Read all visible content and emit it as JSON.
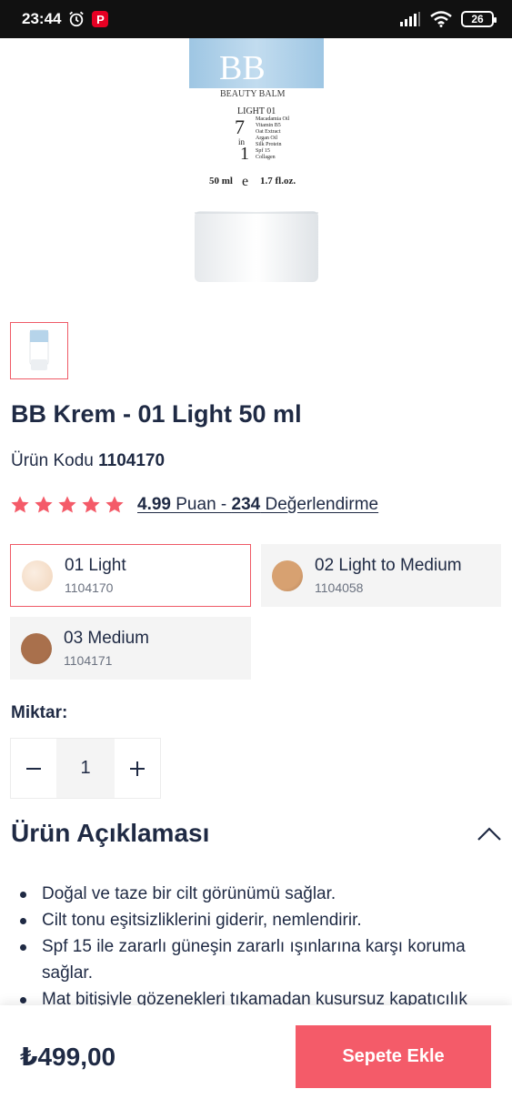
{
  "status_bar": {
    "time": "23:44",
    "battery": "26",
    "pin_badge": "P"
  },
  "product_image": {
    "tube_text": [
      "BB",
      "BEAUTY BALM",
      "LIGHT 01",
      "7",
      "in",
      "1",
      "Macadamia Oil",
      "Vitamin B5",
      "Oat Extract",
      "Argan Oil",
      "Silk Protein",
      "Spf 15",
      "Collagen",
      "50 ml",
      "e",
      "1.7 fl.oz."
    ]
  },
  "product": {
    "title": "BB Krem - 01 Light 50 ml",
    "code_label": "Ürün Kodu",
    "code_value": "1104170"
  },
  "rating": {
    "stars": 5,
    "score": "4.99",
    "score_suffix": " Puan - ",
    "count": "234",
    "count_suffix": " Değerlendirme",
    "star_color": "#f45b69"
  },
  "variants": [
    {
      "name": "01 Light",
      "code": "1104170",
      "color": "#f4dcc6",
      "selected": true
    },
    {
      "name": "02 Light to Medium",
      "code": "1104058",
      "color": "#d7a171",
      "selected": false
    },
    {
      "name": "03 Medium",
      "code": "1104171",
      "color": "#a9704c",
      "selected": false
    }
  ],
  "quantity": {
    "label": "Miktar:",
    "value": "1",
    "minus_icon": "minus-icon",
    "plus_icon": "plus-icon"
  },
  "description": {
    "title": "Ürün Açıklaması",
    "toggle_icon": "chevron-up-icon",
    "items": [
      "Doğal ve taze bir cilt görünümü sağlar.",
      "Cilt tonu eşitsizliklerini giderir, nemlendirir.",
      "Spf 15 ile zararlı güneşin zararlı ışınlarına karşı koruma sağlar.",
      "Mat bitişiyle gözenekleri tıkamadan kusursuz kapatıcılık"
    ]
  },
  "bottom_bar": {
    "price": "₺499,00",
    "cart_label": "Sepete Ekle",
    "accent": "#f45b69"
  }
}
